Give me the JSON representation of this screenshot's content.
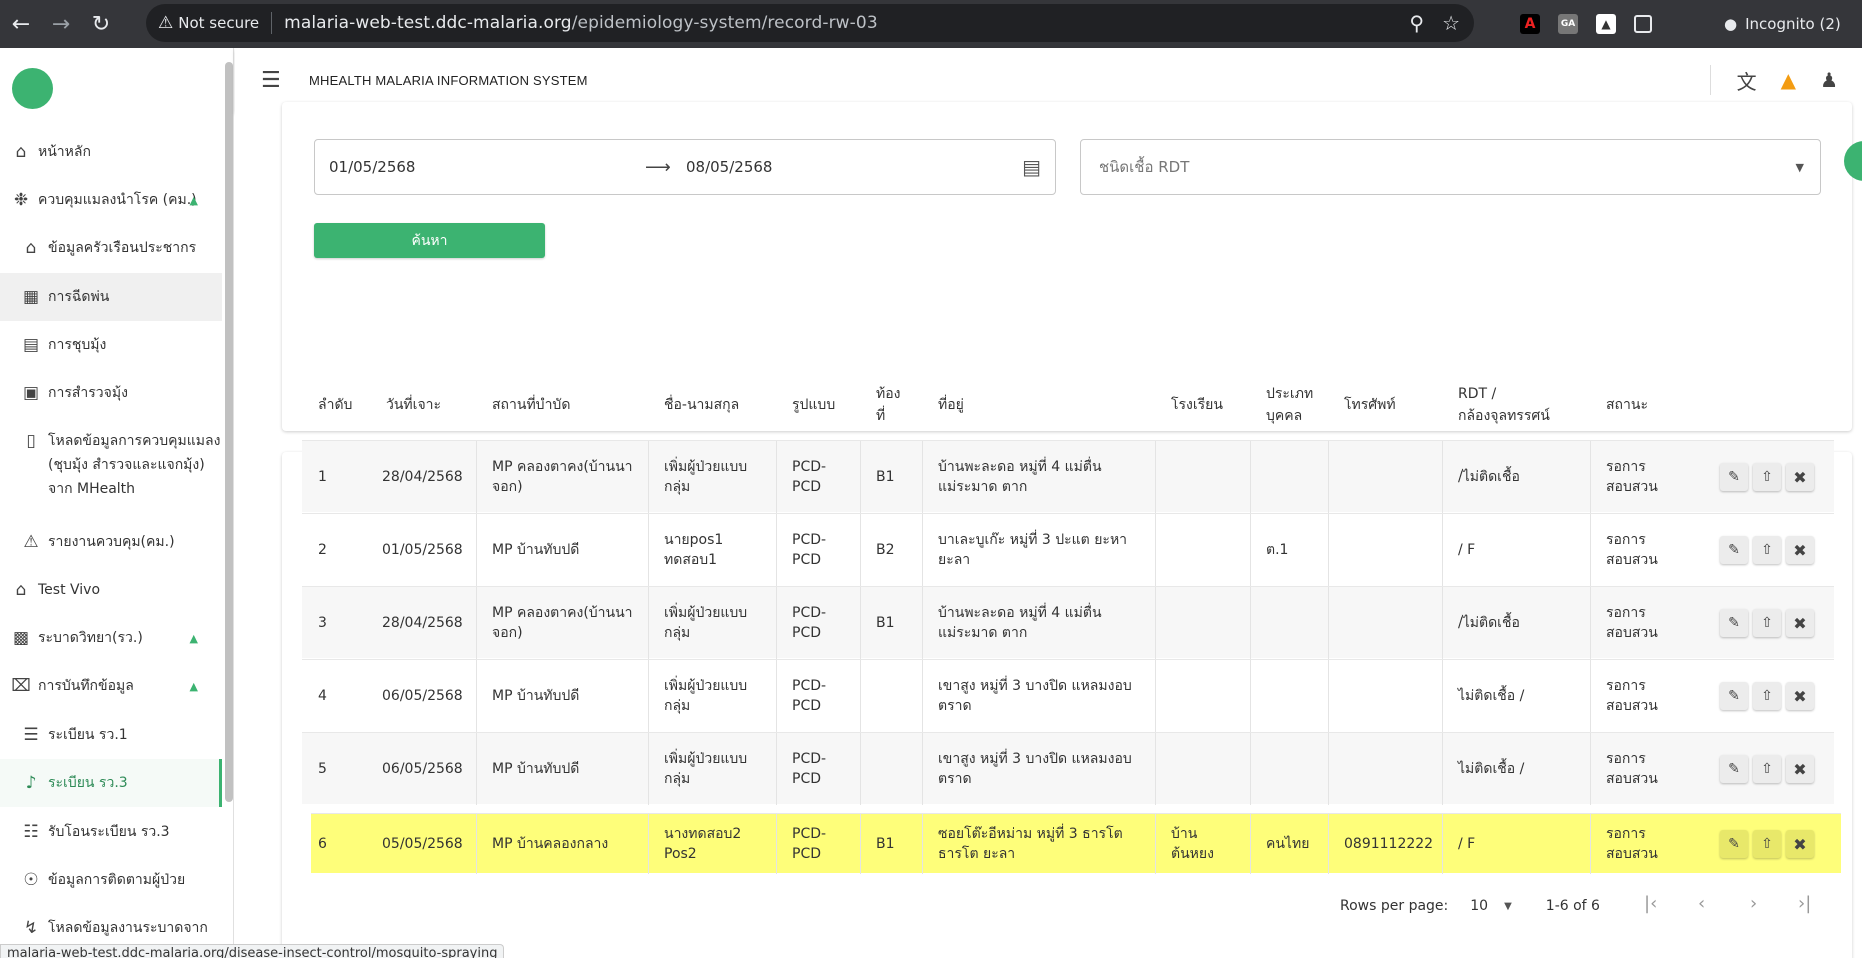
{
  "browser": {
    "back_icon": "arrow-left",
    "forward_icon": "arrow-right",
    "reload_icon": "reload",
    "security_label": "Not secure",
    "url_host": "malaria-web-test.ddc-malaria.org",
    "url_path": "/epidemiology-system/record-rw-03",
    "incognito_label": "Incognito (2)"
  },
  "sidebar": {
    "items": [
      {
        "label": "หน้าหลัก",
        "icon": "home"
      },
      {
        "label": "ควบคุมแมลงนำโรค (คม.)",
        "icon": "bug"
      },
      {
        "label": "ข้อมูลครัวเรือนประชากร",
        "icon": "house"
      },
      {
        "label": "การฉีดพ่น",
        "icon": "spray"
      },
      {
        "label": "การชุบมุ้ง",
        "icon": "bed"
      },
      {
        "label": "การสำรวจมุ้ง",
        "icon": "calendar"
      },
      {
        "label": "โหลดข้อมูลการควบคุมแมลง (ชุบมุ้ง สำรวจและแจกมุ้ง) จาก MHealth",
        "line1": "โหลดข้อมูลการควบคุมแมลง",
        "line2": "(ชุบมุ้ง สำรวจและแจกมุ้ง)",
        "line3": "จาก MHealth",
        "icon": "phone"
      },
      {
        "label": "รายงานควบคุม(คม.)",
        "icon": "warning"
      },
      {
        "label": "Test Vivo",
        "icon": "home"
      },
      {
        "label": "ระบาดวิทยา(รว.)",
        "icon": "download-box"
      },
      {
        "label": "การบันทึกข้อมูล",
        "icon": "close-box"
      },
      {
        "label": "ระเบียน รว.1",
        "icon": "edit-list"
      },
      {
        "label": "ระเบียน รว.3",
        "icon": "music-note"
      },
      {
        "label": "รับโอนระเบียน รว.3",
        "icon": "list-box"
      },
      {
        "label": "ข้อมูลการติดตามผู้ป่วย",
        "icon": "radar"
      },
      {
        "label": "โหลดข้อมูลงานระบาดจาก",
        "icon": "walk"
      }
    ]
  },
  "appbar": {
    "title": "MHEALTH MALARIA INFORMATION SYSTEM"
  },
  "filters": {
    "date_from": "01/05/2568",
    "date_to": "08/05/2568",
    "rdt_placeholder": "ชนิดเชื้อ RDT",
    "search_label": "ค้นหา"
  },
  "table": {
    "headers": {
      "no": "ลำดับ",
      "date": "วันที่เจาะ",
      "place": "สถานที่บำบัด",
      "name": "ชื่อ-นามสกุล",
      "form": "รูปแบบ",
      "local1": "ท้อง",
      "local2": "ที่",
      "address": "ที่อยู่",
      "school": "โรงเรียน",
      "type1": "ประเภท",
      "type2": "บุคคล",
      "phone": "โทรศัพท์",
      "rdt1": "RDT /",
      "rdt2": "กล้องจุลทรรศน์",
      "status": "สถานะ"
    },
    "rows": [
      {
        "no": "1",
        "date": "28/04/2568",
        "place1": "MP คลองตาคง(บ้านนา",
        "place2": "จอก)",
        "name1": "เพิ่มผู้ป่วยแบบ",
        "name2": "กลุ่ม",
        "form1": "PCD-",
        "form2": "PCD",
        "local": "B1",
        "addr1": "บ้านพะละดอ หมู่ที่ 4 แม่ตื่น",
        "addr2": "แม่ระมาด ตาก",
        "school1": "",
        "school2": "",
        "ptype": "",
        "phone": "",
        "rdt": "/ไม่ติดเชื้อ",
        "status1": "รอการ",
        "status2": "สอบสวน"
      },
      {
        "no": "2",
        "date": "01/05/2568",
        "place1": "MP บ้านทับปดี",
        "place2": "",
        "name1": "นายpos1",
        "name2": "ทดสอบ1",
        "form1": "PCD-",
        "form2": "PCD",
        "local": "B2",
        "addr1": "บาเละบูเก๊ะ หมู่ที่ 3 ปะแต ยะหา",
        "addr2": "ยะลา",
        "school1": "",
        "school2": "",
        "ptype": "ต.1",
        "phone": "",
        "rdt": "/ F",
        "status1": "รอการ",
        "status2": "สอบสวน"
      },
      {
        "no": "3",
        "date": "28/04/2568",
        "place1": "MP คลองตาคง(บ้านนา",
        "place2": "จอก)",
        "name1": "เพิ่มผู้ป่วยแบบ",
        "name2": "กลุ่ม",
        "form1": "PCD-",
        "form2": "PCD",
        "local": "B1",
        "addr1": "บ้านพะละดอ หมู่ที่ 4 แม่ตื่น",
        "addr2": "แม่ระมาด ตาก",
        "school1": "",
        "school2": "",
        "ptype": "",
        "phone": "",
        "rdt": "/ไม่ติดเชื้อ",
        "status1": "รอการ",
        "status2": "สอบสวน"
      },
      {
        "no": "4",
        "date": "06/05/2568",
        "place1": "MP บ้านทับปดี",
        "place2": "",
        "name1": "เพิ่มผู้ป่วยแบบ",
        "name2": "กลุ่ม",
        "form1": "PCD-",
        "form2": "PCD",
        "local": "",
        "addr1": "เขาสูง หมู่ที่ 3 บางปิด แหลมงอบ",
        "addr2": "ตราด",
        "school1": "",
        "school2": "",
        "ptype": "",
        "phone": "",
        "rdt": "ไม่ติดเชื้อ /",
        "status1": "รอการ",
        "status2": "สอบสวน"
      },
      {
        "no": "5",
        "date": "06/05/2568",
        "place1": "MP บ้านทับปดี",
        "place2": "",
        "name1": "เพิ่มผู้ป่วยแบบ",
        "name2": "กลุ่ม",
        "form1": "PCD-",
        "form2": "PCD",
        "local": "",
        "addr1": "เขาสูง หมู่ที่ 3 บางปิด แหลมงอบ",
        "addr2": "ตราด",
        "school1": "",
        "school2": "",
        "ptype": "",
        "phone": "",
        "rdt": "ไม่ติดเชื้อ /",
        "status1": "รอการ",
        "status2": "สอบสวน"
      },
      {
        "no": "6",
        "date": "05/05/2568",
        "place1": "MP บ้านคลองกลาง",
        "place2": "",
        "name1": "นางทดสอบ2",
        "name2": "Pos2",
        "form1": "PCD-",
        "form2": "PCD",
        "local": "B1",
        "addr1": "ซอยโต๊ะอีหม่าม หมู่ที่ 3 ธารโต",
        "addr2": "ธารโต ยะลา",
        "school1": "บ้าน",
        "school2": "ต้นหยง",
        "ptype": "คนไทย",
        "phone": "0891112222",
        "rdt": "/ F",
        "status1": "รอการ",
        "status2": "สอบสวน"
      }
    ]
  },
  "pagination": {
    "rows_per_page_label": "Rows per page:",
    "rows_per_page_value": "10",
    "range_label": "1-6 of 6"
  },
  "status_bar": {
    "link": "malaria-web-test.ddc-malaria.org/disease-insect-control/mosquito-spraying"
  },
  "colors": {
    "accent": "#3cb371",
    "highlight_row": "#fefe7a",
    "chrome_bg": "#35363a"
  }
}
